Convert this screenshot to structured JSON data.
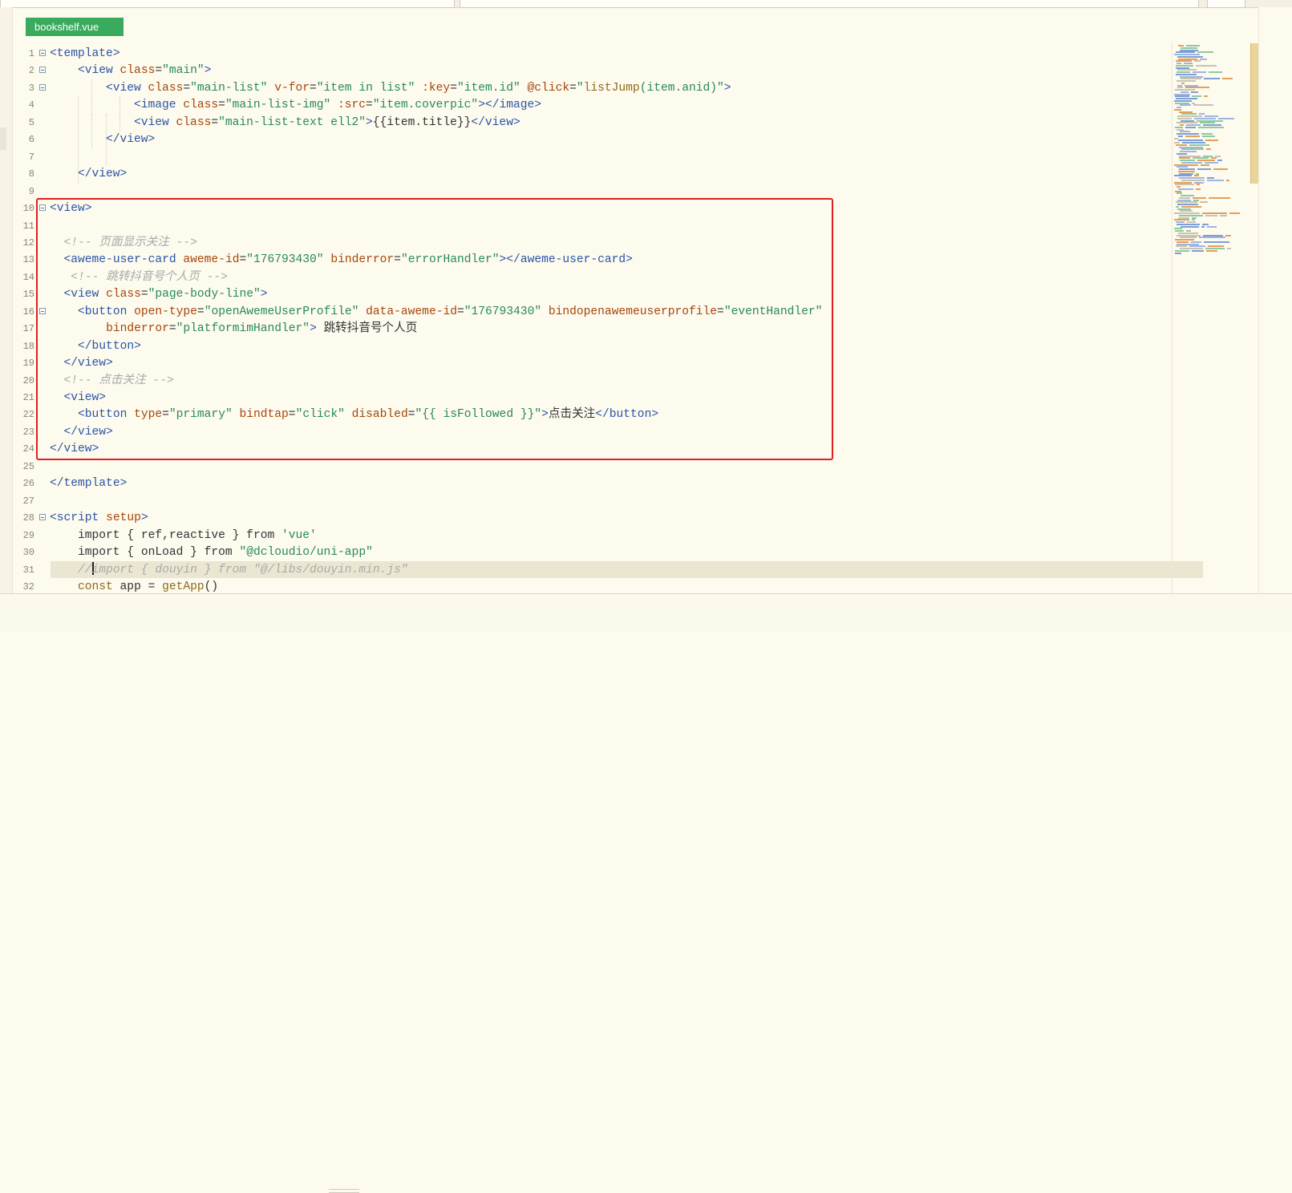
{
  "window": {
    "active_tab": "bookshelf.vue"
  },
  "editor": {
    "lines": [
      {
        "n": "1",
        "fold": true,
        "indent": 0,
        "tokens": [
          [
            "t",
            "<template>"
          ]
        ]
      },
      {
        "n": "2",
        "fold": true,
        "indent": 1,
        "tokens": [
          [
            "t",
            "<view "
          ],
          [
            "a",
            "class"
          ],
          [
            "p",
            "="
          ],
          [
            "s",
            "\"main\""
          ],
          [
            "t",
            ">"
          ]
        ]
      },
      {
        "n": "3",
        "fold": true,
        "indent": 2,
        "tokens": [
          [
            "t",
            "<view "
          ],
          [
            "a",
            "class"
          ],
          [
            "p",
            "="
          ],
          [
            "s",
            "\"main-list\""
          ],
          [
            "p",
            " "
          ],
          [
            "a",
            "v-for"
          ],
          [
            "p",
            "="
          ],
          [
            "s",
            "\"item in list\""
          ],
          [
            "p",
            " "
          ],
          [
            "a",
            ":key"
          ],
          [
            "p",
            "="
          ],
          [
            "s",
            "\"item.id\""
          ],
          [
            "p",
            " "
          ],
          [
            "a",
            "@click"
          ],
          [
            "p",
            "="
          ],
          [
            "s",
            "\""
          ],
          [
            "k",
            "listJump"
          ],
          [
            "s",
            "(item.anid)\""
          ],
          [
            "t",
            ">"
          ]
        ]
      },
      {
        "n": "4",
        "fold": false,
        "indent": 3,
        "tokens": [
          [
            "t",
            "<image "
          ],
          [
            "a",
            "class"
          ],
          [
            "p",
            "="
          ],
          [
            "s",
            "\"main-list-img\""
          ],
          [
            "p",
            " "
          ],
          [
            "a",
            ":src"
          ],
          [
            "p",
            "="
          ],
          [
            "s",
            "\"item.coverpic\""
          ],
          [
            "t",
            "></image>"
          ]
        ]
      },
      {
        "n": "5",
        "fold": false,
        "indent": 3,
        "tokens": [
          [
            "t",
            "<view "
          ],
          [
            "a",
            "class"
          ],
          [
            "p",
            "="
          ],
          [
            "s",
            "\"main-list-text ell2\""
          ],
          [
            "t",
            ">"
          ],
          [
            "p",
            "{{item.title}}"
          ],
          [
            "t",
            "</view>"
          ]
        ]
      },
      {
        "n": "6",
        "fold": false,
        "indent": 2,
        "tokens": [
          [
            "t",
            "</view>"
          ]
        ]
      },
      {
        "n": "7",
        "fold": false,
        "indent": 0,
        "tokens": []
      },
      {
        "n": "8",
        "fold": false,
        "indent": 1,
        "tokens": [
          [
            "t",
            "</view>"
          ]
        ]
      },
      {
        "n": "9",
        "fold": false,
        "indent": 0,
        "tokens": []
      },
      {
        "n": "10",
        "fold": true,
        "indent": 0,
        "tokens": [
          [
            "t",
            "<view>"
          ]
        ]
      },
      {
        "n": "11",
        "fold": false,
        "indent": 0,
        "tokens": []
      },
      {
        "n": "12",
        "fold": false,
        "indent": 0,
        "tokens": [
          [
            "p",
            "  "
          ],
          [
            "c",
            "<!-- 页面显示关注 -->"
          ]
        ]
      },
      {
        "n": "13",
        "fold": false,
        "indent": 0,
        "tokens": [
          [
            "p",
            "  "
          ],
          [
            "t",
            "<aweme-user-card "
          ],
          [
            "a",
            "aweme-id"
          ],
          [
            "p",
            "="
          ],
          [
            "s",
            "\"176793430\""
          ],
          [
            "p",
            " "
          ],
          [
            "a",
            "binderror"
          ],
          [
            "p",
            "="
          ],
          [
            "s",
            "\"errorHandler\""
          ],
          [
            "t",
            "></aweme-user-card>"
          ]
        ]
      },
      {
        "n": "14",
        "fold": false,
        "indent": 0,
        "tokens": [
          [
            "p",
            "   "
          ],
          [
            "c",
            "<!-- 跳转抖音号个人页 -->"
          ]
        ]
      },
      {
        "n": "15",
        "fold": false,
        "indent": 0,
        "tokens": [
          [
            "p",
            "  "
          ],
          [
            "t",
            "<view "
          ],
          [
            "a",
            "class"
          ],
          [
            "p",
            "="
          ],
          [
            "s",
            "\"page-body-line\""
          ],
          [
            "t",
            ">"
          ]
        ]
      },
      {
        "n": "16",
        "fold": true,
        "indent": 0,
        "tokens": [
          [
            "p",
            "    "
          ],
          [
            "t",
            "<button "
          ],
          [
            "a",
            "open-type"
          ],
          [
            "p",
            "="
          ],
          [
            "s",
            "\"openAwemeUserProfile\""
          ],
          [
            "p",
            " "
          ],
          [
            "a",
            "data-aweme-id"
          ],
          [
            "p",
            "="
          ],
          [
            "s",
            "\"176793430\""
          ],
          [
            "p",
            " "
          ],
          [
            "a",
            "bindopenawemeuserprofile"
          ],
          [
            "p",
            "="
          ],
          [
            "s",
            "\"eventHandler\""
          ]
        ]
      },
      {
        "n": "17",
        "fold": false,
        "indent": 0,
        "tokens": [
          [
            "p",
            "        "
          ],
          [
            "a",
            "binderror"
          ],
          [
            "p",
            "="
          ],
          [
            "s",
            "\"platformimHandler\""
          ],
          [
            "t",
            ">"
          ],
          [
            "txt",
            " 跳转抖音号个人页"
          ]
        ]
      },
      {
        "n": "18",
        "fold": false,
        "indent": 0,
        "tokens": [
          [
            "p",
            "    "
          ],
          [
            "t",
            "</button>"
          ]
        ]
      },
      {
        "n": "19",
        "fold": false,
        "indent": 0,
        "tokens": [
          [
            "p",
            "  "
          ],
          [
            "t",
            "</view>"
          ]
        ]
      },
      {
        "n": "20",
        "fold": false,
        "indent": 0,
        "tokens": [
          [
            "p",
            "  "
          ],
          [
            "c",
            "<!-- 点击关注 -->"
          ]
        ]
      },
      {
        "n": "21",
        "fold": false,
        "indent": 0,
        "tokens": [
          [
            "p",
            "  "
          ],
          [
            "t",
            "<view>"
          ]
        ]
      },
      {
        "n": "22",
        "fold": false,
        "indent": 0,
        "tokens": [
          [
            "p",
            "    "
          ],
          [
            "t",
            "<button "
          ],
          [
            "a",
            "type"
          ],
          [
            "p",
            "="
          ],
          [
            "s",
            "\"primary\""
          ],
          [
            "p",
            " "
          ],
          [
            "a",
            "bindtap"
          ],
          [
            "p",
            "="
          ],
          [
            "s",
            "\"click\""
          ],
          [
            "p",
            " "
          ],
          [
            "a",
            "disabled"
          ],
          [
            "p",
            "="
          ],
          [
            "s",
            "\"{{ isFollowed }}\""
          ],
          [
            "t",
            ">"
          ],
          [
            "txt",
            "点击关注"
          ],
          [
            "t",
            "</button>"
          ]
        ]
      },
      {
        "n": "23",
        "fold": false,
        "indent": 0,
        "tokens": [
          [
            "p",
            "  "
          ],
          [
            "t",
            "</view>"
          ]
        ]
      },
      {
        "n": "24",
        "fold": false,
        "indent": 0,
        "tokens": [
          [
            "t",
            "</view>"
          ]
        ]
      },
      {
        "n": "25",
        "fold": false,
        "indent": 0,
        "tokens": []
      },
      {
        "n": "26",
        "fold": false,
        "indent": 0,
        "tokens": [
          [
            "t",
            "</template>"
          ]
        ]
      },
      {
        "n": "27",
        "fold": false,
        "indent": 0,
        "tokens": []
      },
      {
        "n": "28",
        "fold": true,
        "indent": 0,
        "tokens": [
          [
            "t",
            "<script "
          ],
          [
            "a",
            "setup"
          ],
          [
            "t",
            ">"
          ]
        ]
      },
      {
        "n": "29",
        "fold": false,
        "indent": 1,
        "tokens": [
          [
            "p",
            "import { ref,reactive } from "
          ],
          [
            "s",
            "'vue'"
          ]
        ]
      },
      {
        "n": "30",
        "fold": false,
        "indent": 1,
        "tokens": [
          [
            "p",
            "import { onLoad } from "
          ],
          [
            "s",
            "\"@dcloudio/uni-app\""
          ]
        ]
      },
      {
        "n": "31",
        "fold": false,
        "indent": 1,
        "current": true,
        "tokens": [
          [
            "c",
            "//"
          ],
          [
            "cursor",
            ""
          ],
          [
            "c",
            "import { douyin } from \"@/libs/douyin.min.js\""
          ]
        ]
      },
      {
        "n": "32",
        "fold": false,
        "indent": 1,
        "tokens": [
          [
            "k",
            "const"
          ],
          [
            "p",
            " app = "
          ],
          [
            "k",
            "getApp"
          ],
          [
            "p",
            "()"
          ]
        ]
      }
    ]
  },
  "colors": {
    "tab_bg": "#3aaa5d",
    "highlight_box": "#e02020",
    "tag": "#2b55a5",
    "attr": "#a6470b",
    "string": "#268a5a",
    "comment": "#a9a9a9",
    "editor_bg": "#fdfaee"
  }
}
